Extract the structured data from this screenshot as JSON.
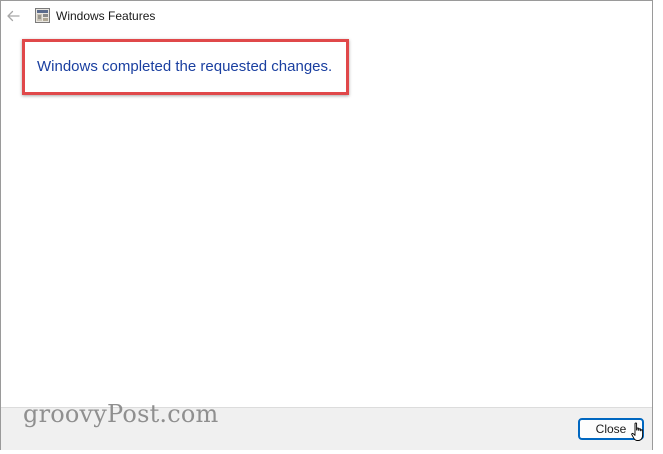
{
  "window": {
    "title": "Windows Features"
  },
  "content": {
    "message": "Windows completed the requested changes."
  },
  "footer": {
    "close_label": "Close",
    "watermark": "groovyPost.com"
  },
  "icons": {
    "back": "arrow-left-icon",
    "app": "windows-features-icon",
    "cursor": "hand-pointer-cursor-icon"
  },
  "colors": {
    "message_text": "#1a3fa0",
    "highlight_border": "#e0484a",
    "button_focus_border": "#0067c0",
    "footer_background": "#f0f0f0"
  }
}
